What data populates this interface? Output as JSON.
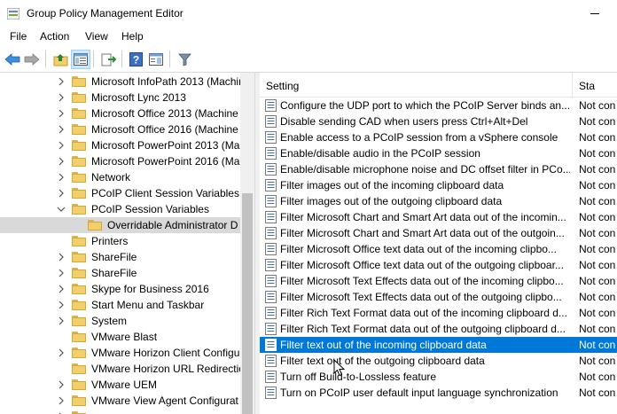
{
  "window": {
    "title": "Group Policy Management Editor"
  },
  "menu": [
    "File",
    "Action",
    "View",
    "Help"
  ],
  "toolbar": {
    "icons": [
      "back-arrow-icon",
      "forward-arrow-icon",
      "folder-up-icon",
      "show-hide-tree-icon",
      "export-list-icon",
      "help-icon",
      "properties-pane-icon",
      "filter-icon"
    ]
  },
  "tree": {
    "items": [
      {
        "label": "Microsoft InfoPath 2013 (Machine",
        "indent": 0,
        "expander": "collapsed",
        "selected": false
      },
      {
        "label": "Microsoft Lync 2013",
        "indent": 0,
        "expander": "collapsed",
        "selected": false
      },
      {
        "label": "Microsoft Office 2013 (Machine",
        "indent": 0,
        "expander": "collapsed",
        "selected": false
      },
      {
        "label": "Microsoft Office 2016 (Machine",
        "indent": 0,
        "expander": "collapsed",
        "selected": false
      },
      {
        "label": "Microsoft PowerPoint 2013 (Ma",
        "indent": 0,
        "expander": "collapsed",
        "selected": false
      },
      {
        "label": "Microsoft PowerPoint 2016 (Ma",
        "indent": 0,
        "expander": "collapsed",
        "selected": false
      },
      {
        "label": "Network",
        "indent": 0,
        "expander": "collapsed",
        "selected": false
      },
      {
        "label": "PCoIP Client Session Variables",
        "indent": 0,
        "expander": "collapsed",
        "selected": false
      },
      {
        "label": "PCoIP Session Variables",
        "indent": 0,
        "expander": "expanded",
        "selected": false
      },
      {
        "label": "Overridable Administrator D",
        "indent": 1,
        "expander": "none",
        "selected": true
      },
      {
        "label": "Printers",
        "indent": 0,
        "expander": "none",
        "selected": false
      },
      {
        "label": "ShareFile",
        "indent": 0,
        "expander": "collapsed",
        "selected": false
      },
      {
        "label": "ShareFile",
        "indent": 0,
        "expander": "collapsed",
        "selected": false
      },
      {
        "label": "Skype for Business 2016",
        "indent": 0,
        "expander": "collapsed",
        "selected": false
      },
      {
        "label": "Start Menu and Taskbar",
        "indent": 0,
        "expander": "collapsed",
        "selected": false
      },
      {
        "label": "System",
        "indent": 0,
        "expander": "collapsed",
        "selected": false
      },
      {
        "label": "VMware Blast",
        "indent": 0,
        "expander": "none",
        "selected": false
      },
      {
        "label": "VMware Horizon Client Configu",
        "indent": 0,
        "expander": "collapsed",
        "selected": false
      },
      {
        "label": "VMware Horizon URL Redirectio",
        "indent": 0,
        "expander": "none",
        "selected": false
      },
      {
        "label": "VMware UEM",
        "indent": 0,
        "expander": "collapsed",
        "selected": false
      },
      {
        "label": "VMware View Agent Configurat",
        "indent": 0,
        "expander": "collapsed",
        "selected": false
      },
      {
        "label": "",
        "indent": 0,
        "expander": "collapsed",
        "selected": false
      }
    ]
  },
  "list": {
    "columns": {
      "setting": "Setting",
      "state": "Sta"
    },
    "rows": [
      {
        "setting": "Configure the UDP port to which the PCoIP Server binds an...",
        "state": "Not con",
        "selected": false
      },
      {
        "setting": "Disable sending CAD when users press Ctrl+Alt+Del",
        "state": "Not con",
        "selected": false
      },
      {
        "setting": "Enable access to a PCoIP session from a vSphere console",
        "state": "Not con",
        "selected": false
      },
      {
        "setting": "Enable/disable audio in the PCoIP session",
        "state": "Not con",
        "selected": false
      },
      {
        "setting": "Enable/disable microphone noise and DC offset filter in PCo...",
        "state": "Not con",
        "selected": false
      },
      {
        "setting": "Filter images out of the incoming clipboard data",
        "state": "Not con",
        "selected": false
      },
      {
        "setting": "Filter images out of the outgoing clipboard data",
        "state": "Not con",
        "selected": false
      },
      {
        "setting": "Filter Microsoft Chart and Smart Art data out of the incomin...",
        "state": "Not con",
        "selected": false
      },
      {
        "setting": "Filter Microsoft Chart and Smart Art data out of the outgoin...",
        "state": "Not con",
        "selected": false
      },
      {
        "setting": "Filter Microsoft Office text data out of the incoming clipbo...",
        "state": "Not con",
        "selected": false
      },
      {
        "setting": "Filter Microsoft Office text data out of the outgoing clipboar...",
        "state": "Not con",
        "selected": false
      },
      {
        "setting": "Filter Microsoft Text Effects data out of the incoming clipbo...",
        "state": "Not con",
        "selected": false
      },
      {
        "setting": "Filter Microsoft Text Effects data out of the outgoing clipbo...",
        "state": "Not con",
        "selected": false
      },
      {
        "setting": "Filter Rich Text Format data out of the incoming clipboard d...",
        "state": "Not con",
        "selected": false
      },
      {
        "setting": "Filter Rich Text Format data out of the outgoing clipboard d...",
        "state": "Not con",
        "selected": false
      },
      {
        "setting": "Filter text out of the incoming clipboard data",
        "state": "Not con",
        "selected": true
      },
      {
        "setting": "Filter text out of the outgoing clipboard data",
        "state": "Not con",
        "selected": false
      },
      {
        "setting": "Turn off Build-to-Lossless feature",
        "state": "Not con",
        "selected": false
      },
      {
        "setting": "Turn on PCoIP user default input language synchronization",
        "state": "Not con",
        "selected": false
      }
    ]
  },
  "colors": {
    "selection": "#0078d7",
    "tree_selection": "#d9d9d9",
    "folder": "#f3cf6b"
  }
}
